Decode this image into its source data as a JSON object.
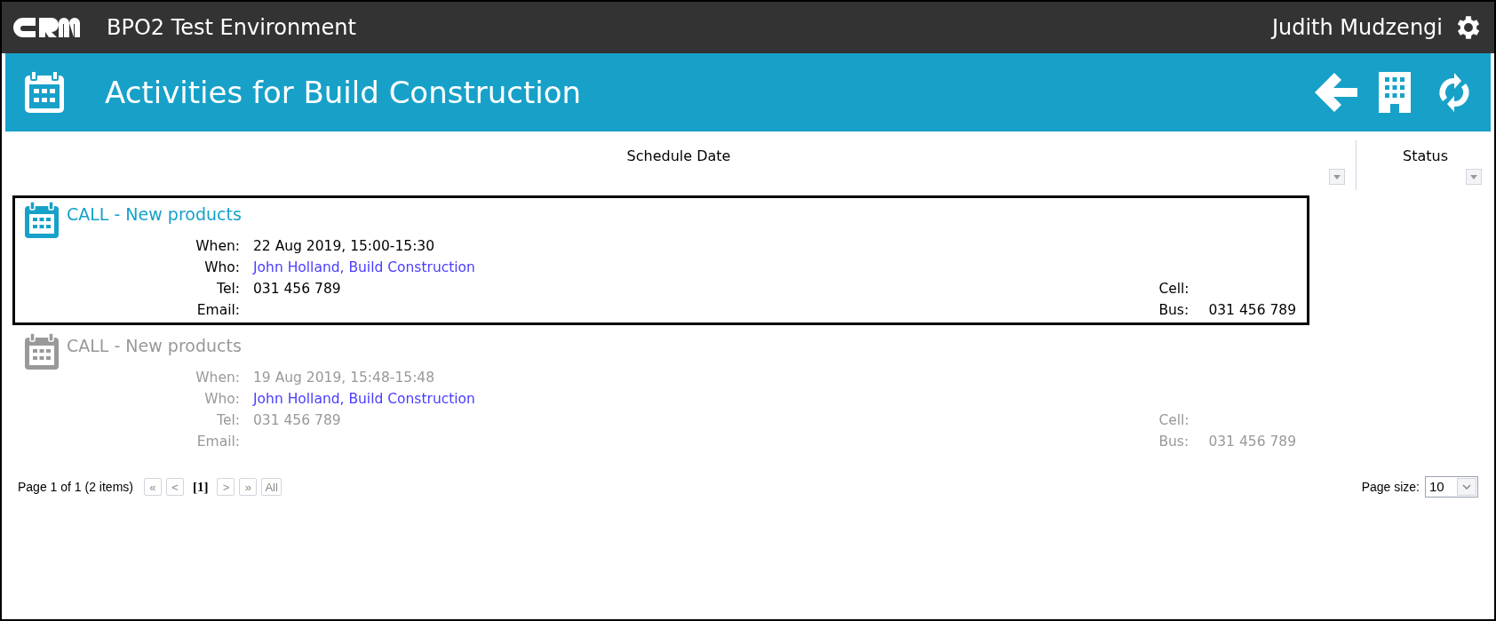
{
  "top_bar": {
    "app_title": "BPO2 Test Environment",
    "user_name": "Judith Mudzengi"
  },
  "header": {
    "title": "Activities for Build Construction"
  },
  "columns": [
    {
      "label": "Schedule Date"
    },
    {
      "label": "Status"
    }
  ],
  "activities": [
    {
      "title": "CALL - New products",
      "selected": true,
      "completed": false,
      "when_label": "When:",
      "when": "22 Aug 2019, 15:00-15:30",
      "who_label": "Who:",
      "who": "John Holland, Build Construction",
      "tel_label": "Tel:",
      "tel": "031 456 789",
      "email_label": "Email:",
      "cell_label": "Cell:",
      "bus_label": "Bus:",
      "bus": "031 456 789"
    },
    {
      "title": "CALL - New products",
      "selected": false,
      "completed": true,
      "when_label": "When:",
      "when": "19 Aug 2019, 15:48-15:48",
      "who_label": "Who:",
      "who": "John Holland, Build Construction",
      "tel_label": "Tel:",
      "tel": "031 456 789",
      "email_label": "Email:",
      "cell_label": "Cell:",
      "bus_label": "Bus:",
      "bus": "031 456 789"
    }
  ],
  "pager": {
    "summary": "Page 1 of 1 (2 items)",
    "buttons_before": [
      {
        "label": "«",
        "disabled": true
      },
      {
        "label": "<",
        "disabled": true
      }
    ],
    "current": "[1]",
    "buttons_after": [
      {
        "label": ">",
        "disabled": true
      },
      {
        "label": "»",
        "disabled": true
      },
      {
        "label": "All",
        "disabled": true
      }
    ],
    "page_size_label": "Page size:",
    "page_size": "10"
  }
}
